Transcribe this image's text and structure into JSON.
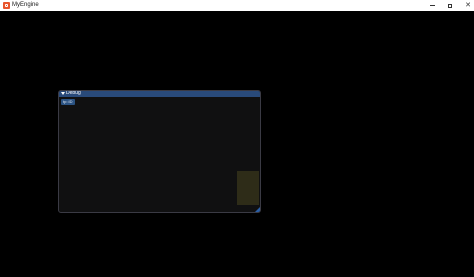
{
  "window": {
    "title": "MyEngine",
    "accent_color": "#e8542c",
    "controls": {
      "minimize_icon": "minimize-icon",
      "maximize_icon": "maximize-icon",
      "close_icon": "close-icon",
      "close_glyph": "✕"
    }
  },
  "debug_panel": {
    "title": "Debug",
    "collapse_icon": "triangle-down-icon",
    "button_label": "tp::ID",
    "titlebar_color": "#294a7a",
    "button_color": "#2b5383"
  }
}
